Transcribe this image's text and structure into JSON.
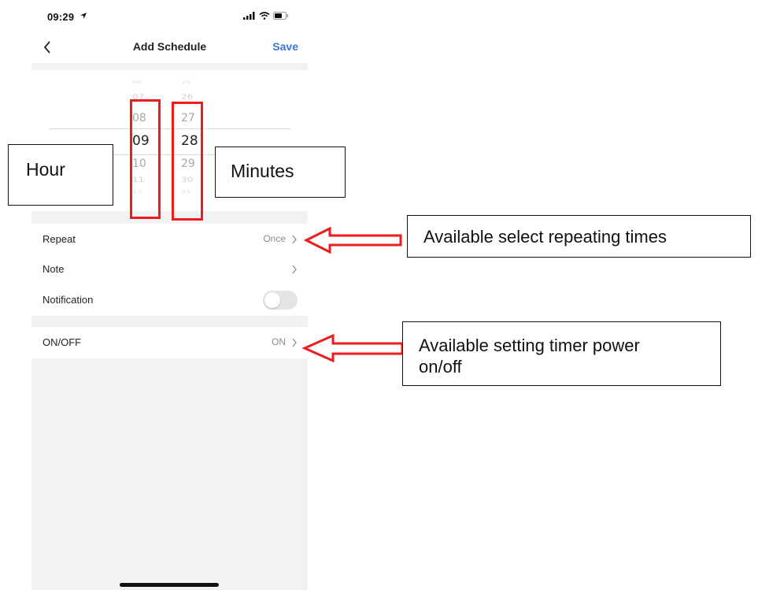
{
  "status_bar": {
    "time": "09:29"
  },
  "nav": {
    "title": "Add Schedule",
    "save_label": "Save"
  },
  "picker": {
    "hours": [
      "06",
      "07",
      "08",
      "09",
      "10",
      "11",
      "12"
    ],
    "minutes": [
      "25",
      "26",
      "27",
      "28",
      "29",
      "30",
      "31"
    ],
    "selected_hour": "09",
    "selected_minute": "28"
  },
  "settings": {
    "repeat": {
      "label": "Repeat",
      "value": "Once"
    },
    "note": {
      "label": "Note"
    },
    "notification": {
      "label": "Notification",
      "enabled": false
    },
    "on_off": {
      "label": "ON/OFF",
      "value": "ON"
    }
  },
  "annotations": {
    "hour": "Hour",
    "minutes": "Minutes",
    "repeat_note": "Available select repeating times",
    "timer_note_line1": "Available setting timer power",
    "timer_note_line2": "on/off"
  },
  "colors": {
    "accent": "#3a77d8",
    "annotation_red": "#ee1c1c"
  }
}
